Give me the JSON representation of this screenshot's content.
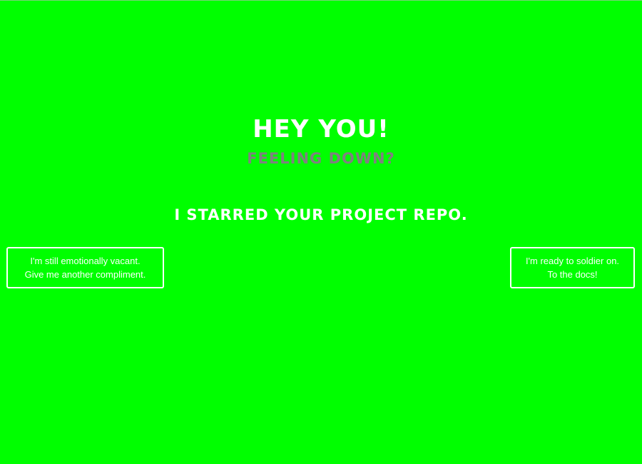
{
  "page": {
    "background_color": "#00ff00",
    "title": "Hey You!",
    "subtitle": "Feeling down?",
    "message": "I starred your project repo."
  },
  "buttons": {
    "compliment": {
      "line1": "I'm still emotionally vacant.",
      "line2": "Give me another compliment."
    },
    "docs": {
      "line1": "I'm ready to soldier on.",
      "line2": "To the docs!"
    }
  },
  "colors": {
    "accent_text": "#ffffff",
    "subtitle_text": "#808080"
  }
}
